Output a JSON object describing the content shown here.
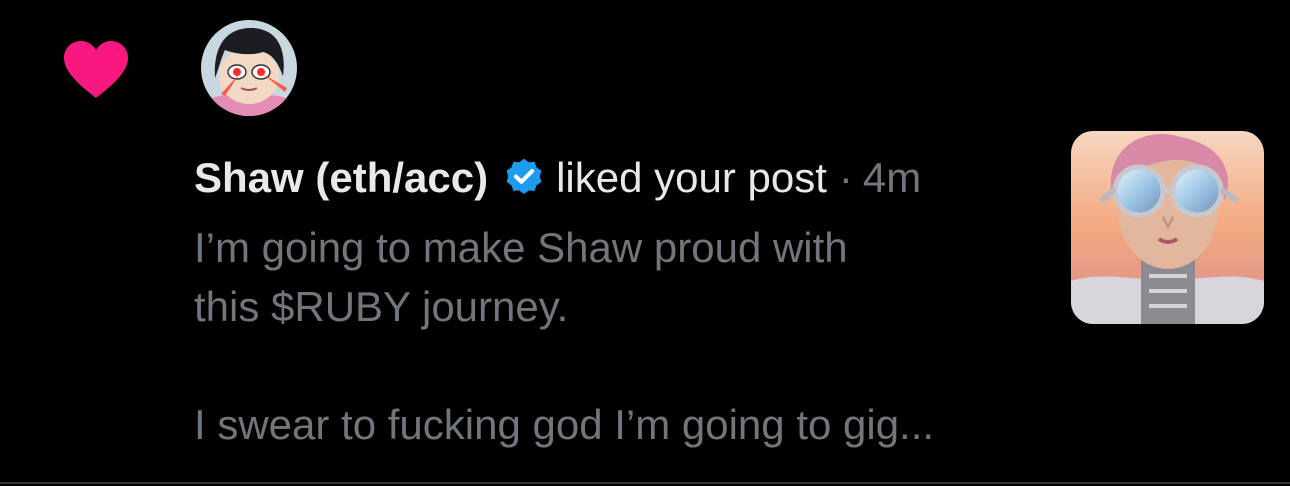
{
  "notification": {
    "type_icon": "heart-icon",
    "user_name": "Shaw (eth/acc)",
    "verified_icon": "verified-badge-icon",
    "action": "liked your post",
    "separator": "·",
    "timestamp": "4m",
    "post_lines": [
      "I’m going to make Shaw proud with",
      "this $RUBY journey.",
      "I swear to fucking god I’m going to gig..."
    ],
    "avatar": "user-avatar-image",
    "thumbnail": "post-media-thumbnail"
  },
  "colors": {
    "background": "#000000",
    "heart": "#f91880",
    "verified": "#1d9bf0",
    "primary_text": "#e7e9ea",
    "secondary_text": "#71767b"
  }
}
